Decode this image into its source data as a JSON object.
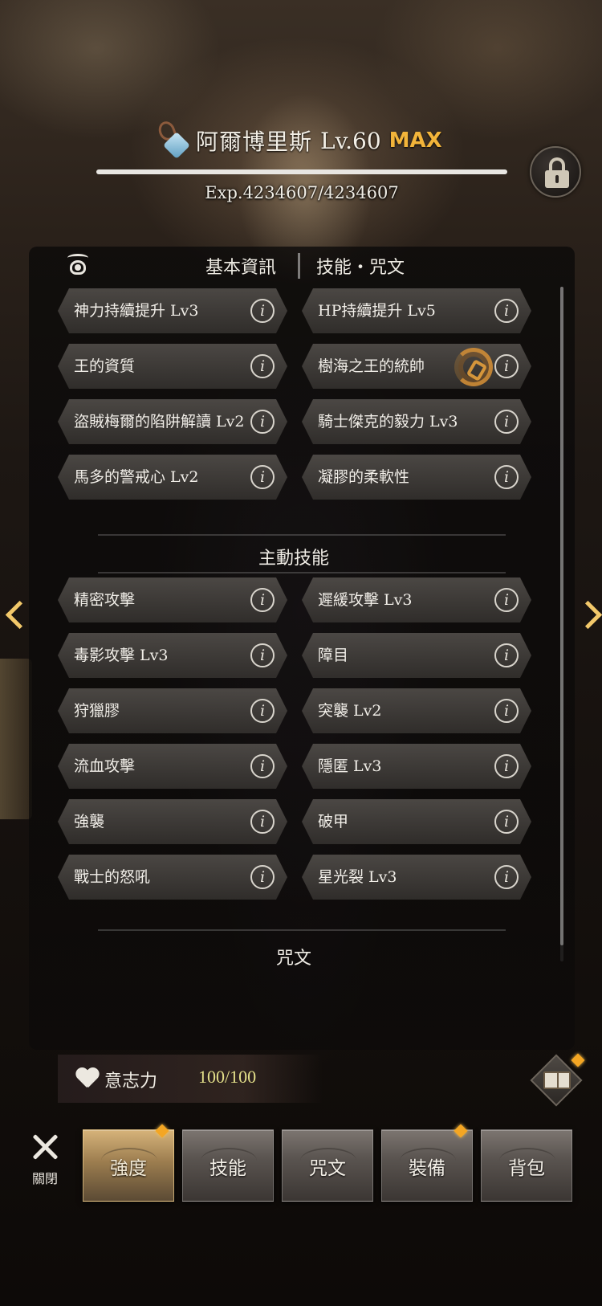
{
  "character": {
    "name": "阿爾博里斯",
    "level": "Lv.60",
    "max_label": "MAX",
    "exp_text": "Exp.4234607/4234607",
    "exp_fraction": 1.0
  },
  "tabs": {
    "basic_info": "基本資訊",
    "skills_runes": "技能・咒文"
  },
  "passive_skills": [
    {
      "name": "神力持續提升 Lv3"
    },
    {
      "name": "HP持續提升 Lv5"
    },
    {
      "name": "王的資質"
    },
    {
      "name": "樹海之王的統帥",
      "linked": true
    },
    {
      "name": "盜賊梅爾的陷阱解讀 Lv2"
    },
    {
      "name": "騎士傑克的毅力 Lv3"
    },
    {
      "name": "馬多的警戒心 Lv2"
    },
    {
      "name": "凝膠的柔軟性"
    }
  ],
  "active_section_title": "主動技能",
  "active_skills": [
    {
      "name": "精密攻擊"
    },
    {
      "name": "遲緩攻擊 Lv3"
    },
    {
      "name": "毒影攻擊 Lv3"
    },
    {
      "name": "障目"
    },
    {
      "name": "狩獵膠"
    },
    {
      "name": "突襲 Lv2"
    },
    {
      "name": "流血攻擊"
    },
    {
      "name": "隱匿 Lv3"
    },
    {
      "name": "強襲"
    },
    {
      "name": "破甲"
    },
    {
      "name": "戰士的怒吼"
    },
    {
      "name": "星光裂 Lv3"
    }
  ],
  "rune_section_title": "咒文",
  "info_icon_glyph": "i",
  "willpower": {
    "label": "意志力",
    "value": "100/100"
  },
  "bottom_nav": {
    "close_label": "關閉",
    "items": [
      {
        "label": "強度",
        "active": true,
        "badge": true
      },
      {
        "label": "技能",
        "active": false,
        "badge": false
      },
      {
        "label": "咒文",
        "active": false,
        "badge": false
      },
      {
        "label": "裝備",
        "active": false,
        "badge": true
      },
      {
        "label": "背包",
        "active": false,
        "badge": false
      }
    ]
  },
  "colors": {
    "max": "#f2b43a",
    "willpower_value": "#e4e08a",
    "badge": "#f4a623",
    "nav_arrow": "#f2c86a"
  }
}
